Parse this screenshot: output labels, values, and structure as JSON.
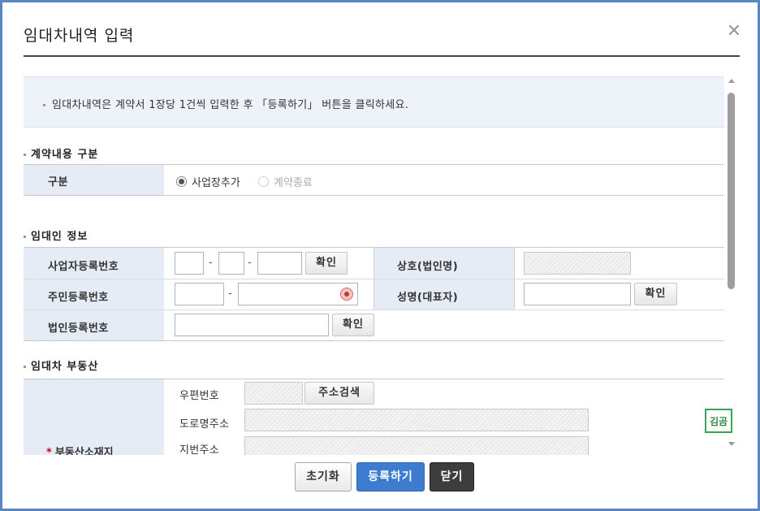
{
  "dialog": {
    "title": "임대차내역 입력",
    "close_icon": "close-icon"
  },
  "notice": {
    "text": "임대차내역은 계약서 1장당 1건씩 입력한 후 「등록하기」 버튼을 클릭하세요."
  },
  "contract_section": {
    "title": "계약내용 구분",
    "row_label": "구분",
    "options": [
      {
        "label": "사업장추가",
        "selected": true
      },
      {
        "label": "계약종료",
        "selected": false
      }
    ]
  },
  "lessor_section": {
    "title": "임대인 정보",
    "biz_reg_label": "사업자등록번호",
    "confirm_label": "확인",
    "trade_name_label": "상호(법인명)",
    "resident_label": "주민등록번호",
    "rep_name_label": "성명(대표자)",
    "corp_reg_label": "법인등록번호"
  },
  "property_section": {
    "title": "임대차 부동산",
    "location_label": "부동산소재지",
    "postal_label": "우편번호",
    "address_search_label": "주소검색",
    "road_label": "도로명주소",
    "lot_label": "지번주소"
  },
  "footer": {
    "reset": "초기화",
    "register": "등록하기",
    "close": "닫기"
  },
  "badge": {
    "text": "김곰"
  }
}
